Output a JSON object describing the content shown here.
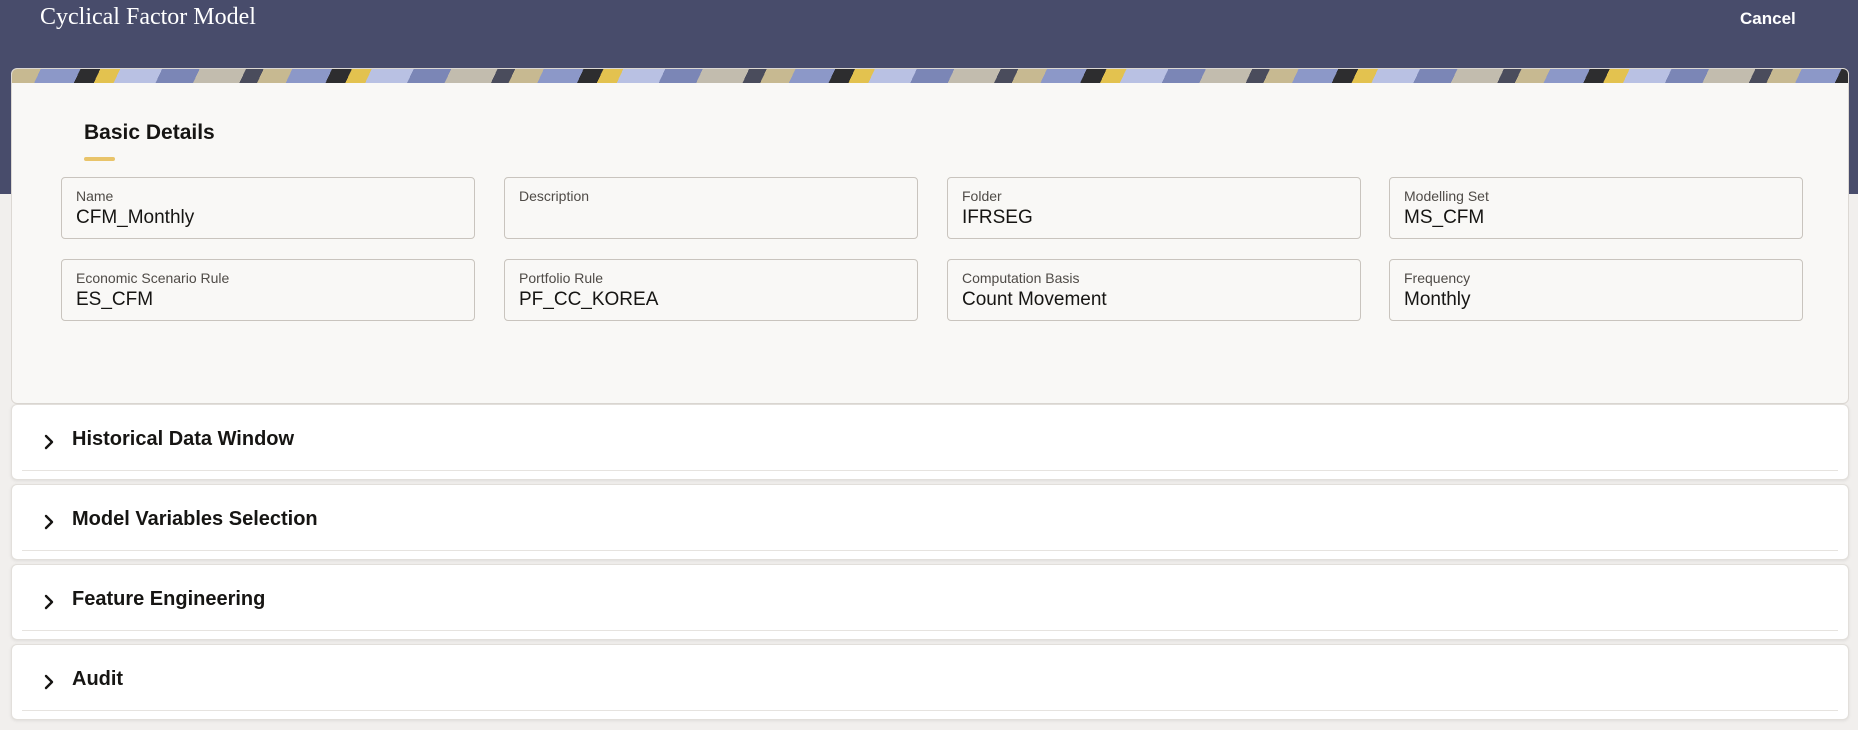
{
  "app": {
    "title": "Cyclical Factor Model",
    "cancel_label": "Cancel"
  },
  "basic_details": {
    "title": "Basic Details",
    "fields": [
      {
        "label": "Name",
        "value": "CFM_Monthly"
      },
      {
        "label": "Description",
        "value": ""
      },
      {
        "label": "Folder",
        "value": "IFRSEG"
      },
      {
        "label": "Modelling Set",
        "value": "MS_CFM"
      },
      {
        "label": "Economic Scenario Rule",
        "value": "ES_CFM"
      },
      {
        "label": "Portfolio Rule",
        "value": "PF_CC_KOREA"
      },
      {
        "label": "Computation Basis",
        "value": "Count Movement"
      },
      {
        "label": "Frequency",
        "value": "Monthly"
      }
    ]
  },
  "sections": [
    {
      "title": "Historical Data Window",
      "icon": "chevron-right-icon"
    },
    {
      "title": "Model Variables Selection",
      "icon": "chevron-right-icon"
    },
    {
      "title": "Feature Engineering",
      "icon": "chevron-right-icon"
    },
    {
      "title": "Audit",
      "icon": "chevron-right-icon"
    }
  ],
  "colors": {
    "header": "#484c6b",
    "accent": "#e9c46a",
    "card": "#f9f8f6"
  }
}
